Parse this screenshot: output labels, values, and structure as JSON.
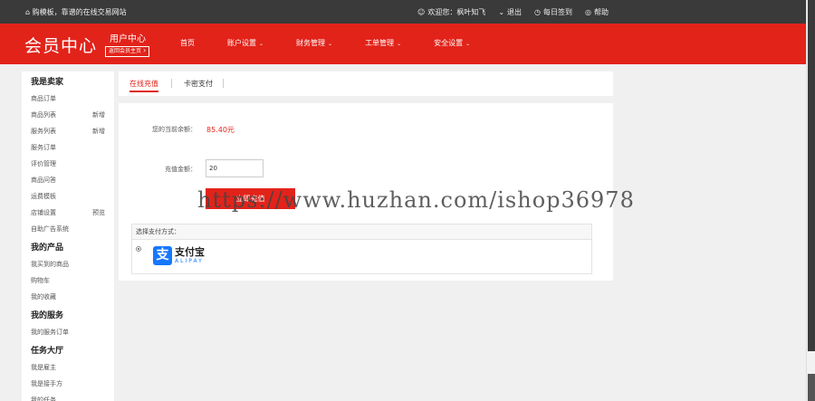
{
  "topbar": {
    "tagline": "购模板，靠谱的在线交易网站",
    "welcome": "欢迎您：枫叶知飞",
    "logout": "退出",
    "checkin": "每日签到",
    "help": "帮助"
  },
  "header": {
    "logo": "会员中心",
    "user_center": "用户中心",
    "back_home": "返回会员主页",
    "nav": [
      {
        "label": "首页",
        "dropdown": false
      },
      {
        "label": "账户设置",
        "dropdown": true
      },
      {
        "label": "财务管理",
        "dropdown": true
      },
      {
        "label": "工单管理",
        "dropdown": true
      },
      {
        "label": "安全设置",
        "dropdown": true
      }
    ]
  },
  "sidebar": {
    "sections": [
      {
        "title": "我是卖家",
        "items": [
          {
            "label": "商品订单",
            "tag": ""
          },
          {
            "label": "商品列表",
            "tag": "新增"
          },
          {
            "label": "服务列表",
            "tag": "新增"
          },
          {
            "label": "服务订单",
            "tag": ""
          },
          {
            "label": "评价管理",
            "tag": ""
          },
          {
            "label": "商品问答",
            "tag": ""
          },
          {
            "label": "运费模板",
            "tag": ""
          },
          {
            "label": "店铺设置",
            "tag": "预览"
          },
          {
            "label": "自助广告系统",
            "tag": ""
          }
        ]
      },
      {
        "title": "我的产品",
        "items": [
          {
            "label": "我买到的商品",
            "tag": ""
          },
          {
            "label": "购物车",
            "tag": ""
          },
          {
            "label": "我的收藏",
            "tag": ""
          }
        ]
      },
      {
        "title": "我的服务",
        "items": [
          {
            "label": "我的服务订单",
            "tag": ""
          }
        ]
      },
      {
        "title": "任务大厅",
        "items": [
          {
            "label": "我是雇主",
            "tag": ""
          },
          {
            "label": "我是接手方",
            "tag": ""
          },
          {
            "label": "我的任务",
            "tag": ""
          }
        ]
      }
    ]
  },
  "tabs": {
    "online": "在线充值",
    "card": "卡密支付"
  },
  "recharge": {
    "balance_label": "您的当前余额：",
    "balance_value": "85.40元",
    "amount_label": "充值金额：",
    "amount_value": "20",
    "submit": "立即充值",
    "pay_method_title": "选择支付方式：",
    "alipay_cn": "支付宝",
    "alipay_en": "ALIPAY"
  },
  "watermark": "https://www.huzhan.com/ishop36978",
  "colors": {
    "brand_red": "#e2231a",
    "topbar": "#3a3a3a",
    "alipay_blue": "#1677ff"
  }
}
